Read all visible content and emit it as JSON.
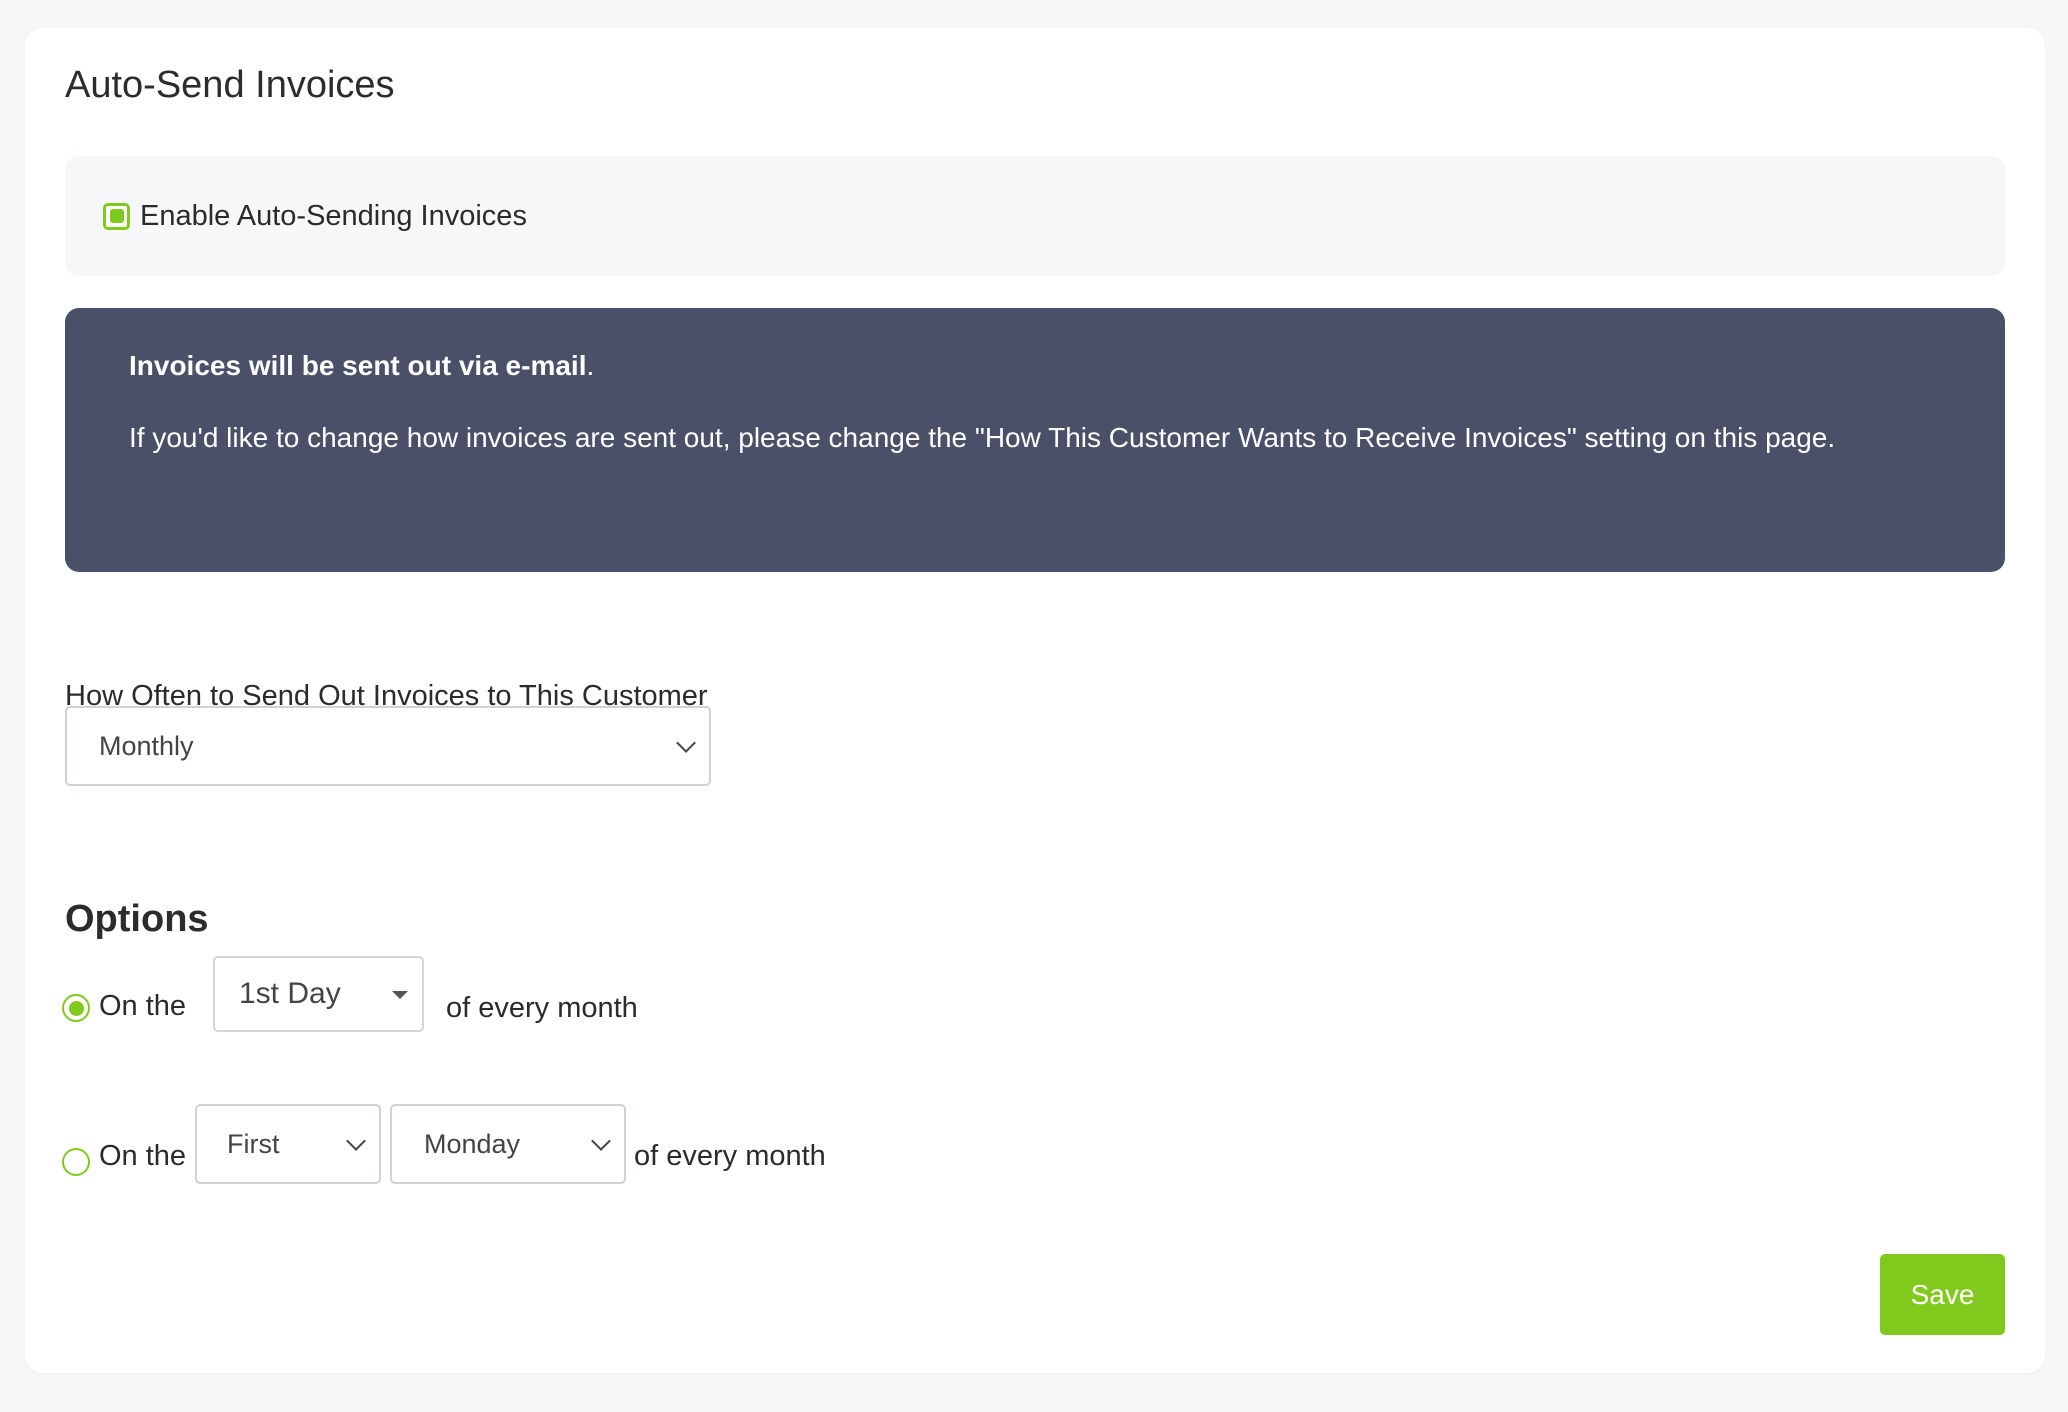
{
  "page": {
    "title": "Auto-Send Invoices"
  },
  "enable": {
    "label": "Enable Auto-Sending Invoices",
    "checked": true
  },
  "info": {
    "strong": "Invoices will be sent out via e-mail",
    "strong_suffix": ".",
    "text": "If you'd like to change how invoices are sent out, please change the \"How This Customer Wants to Receive Invoices\" setting on this page."
  },
  "frequency": {
    "label": "How Often to Send Out Invoices to This Customer",
    "selected": "Monthly"
  },
  "options": {
    "title": "Options",
    "option1": {
      "prefix": "On the",
      "day_selected": "1st Day",
      "suffix": "of every month",
      "selected": true
    },
    "option2": {
      "prefix": "On the",
      "ordinal_selected": "First",
      "weekday_selected": "Monday",
      "suffix": "of every month",
      "selected": false
    }
  },
  "actions": {
    "save_label": "Save"
  },
  "colors": {
    "accent": "#82c91e",
    "info_bg": "#4a5068",
    "panel_bg": "#f6f7f9"
  }
}
